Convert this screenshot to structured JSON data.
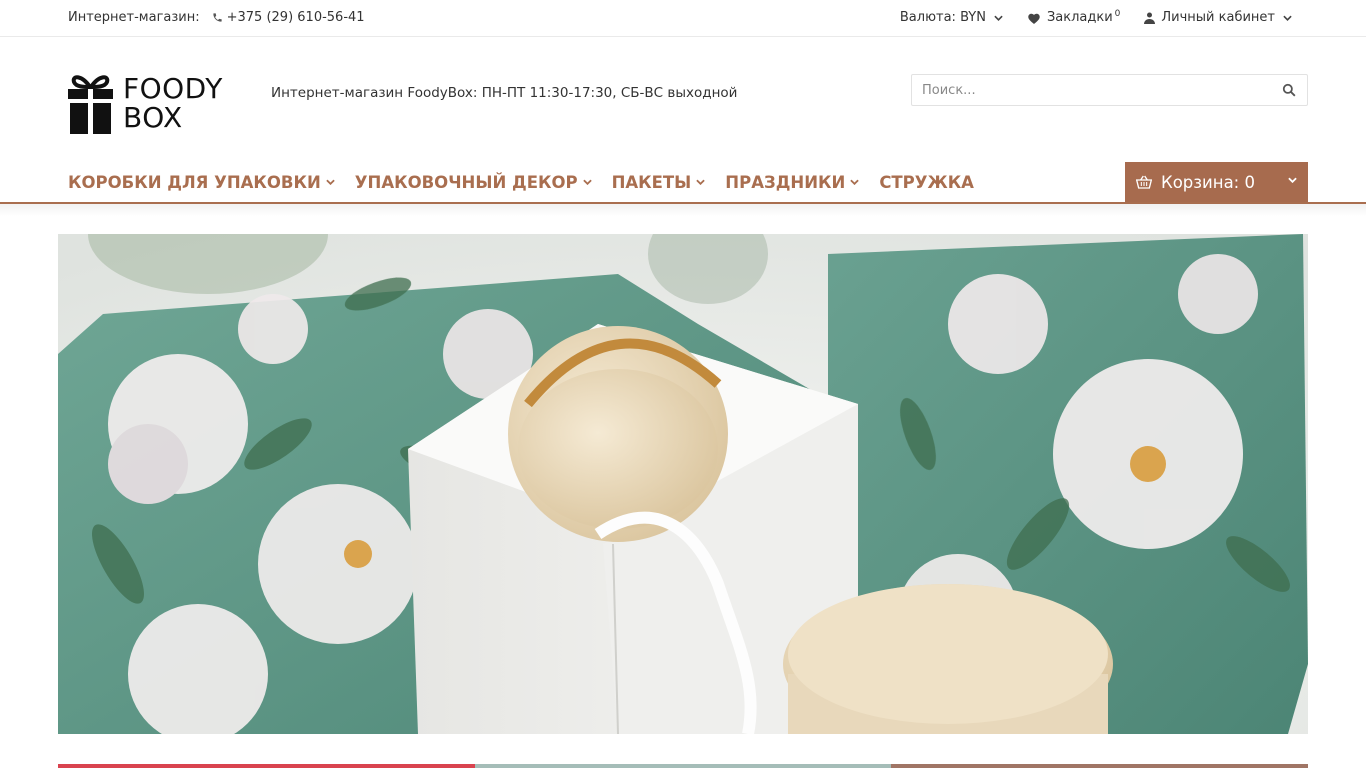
{
  "topbar": {
    "shop_label": "Интернет-магазин:",
    "phone": "+375 (29) 610-56-41",
    "currency": "Валюта: BYN",
    "bookmarks": "Закладки",
    "bookmarks_count": "0",
    "account": "Личный кабинет"
  },
  "header": {
    "logo_line1": "FOODY",
    "logo_line2": "BOX",
    "tagline": "Интернет-магазин FoodyBox: ПН-ПТ 11:30-17:30, СБ-ВС выходной"
  },
  "search": {
    "placeholder": "Поиск..."
  },
  "menu": {
    "items": [
      {
        "label": "КОРОБКИ ДЛЯ УПАКОВКИ"
      },
      {
        "label": "УПАКОВОЧНЫЙ ДЕКОР"
      },
      {
        "label": "ПАКЕТЫ"
      },
      {
        "label": "ПРАЗДНИКИ"
      },
      {
        "label": "СТРУЖКА"
      }
    ]
  },
  "cart": {
    "label": "Корзина: 0"
  },
  "colors": {
    "brand": "#a96e4f",
    "cart_bg": "#a76b4e",
    "stripe_red": "#d9434f",
    "stripe_teal": "#a5bdb8",
    "stripe_brown": "#a07565"
  }
}
